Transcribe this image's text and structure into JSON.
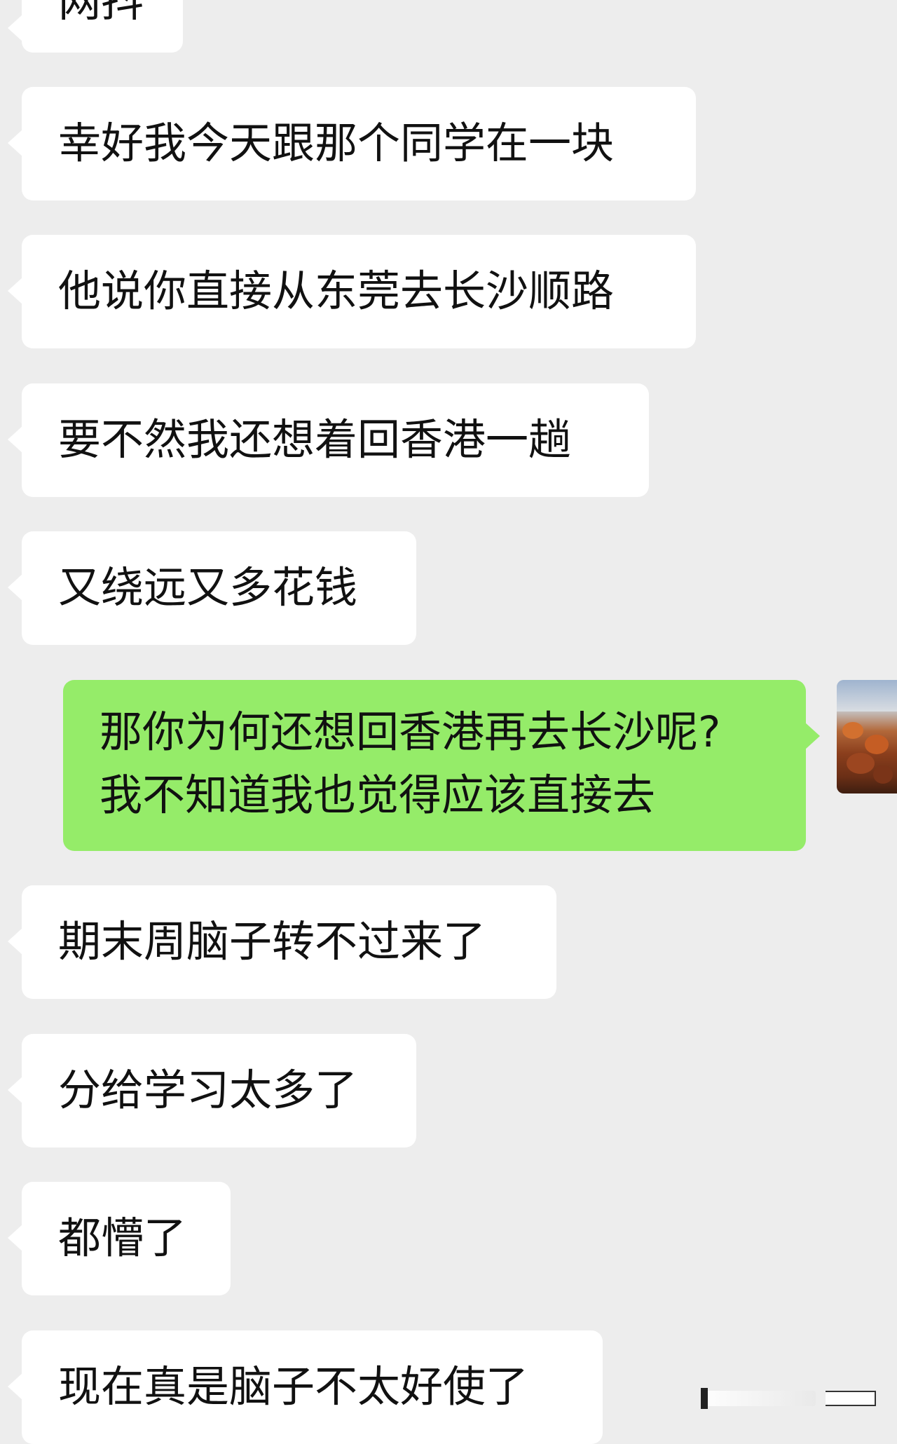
{
  "messages": [
    {
      "side": "in",
      "text": "网抖"
    },
    {
      "side": "in",
      "text": "幸好我今天跟那个同学在一块"
    },
    {
      "side": "in",
      "text": "他说你直接从东莞去长沙顺路"
    },
    {
      "side": "in",
      "text": "要不然我还想着回香港一趟"
    },
    {
      "side": "in",
      "text": "又绕远又多花钱"
    },
    {
      "side": "out",
      "lines": [
        "那你为何还想回香港再去长沙呢?",
        "我不知道我也觉得应该直接去"
      ]
    },
    {
      "side": "in",
      "text": "期末周脑子转不过来了"
    },
    {
      "side": "in",
      "text": "分给学习太多了"
    },
    {
      "side": "in",
      "text": "都懵了"
    },
    {
      "side": "in",
      "text": "现在真是脑子不太好使了"
    }
  ],
  "avatar_icon": "user-avatar-photo",
  "colors": {
    "background": "#ededed",
    "incoming_bubble": "#ffffff",
    "outgoing_bubble": "#95ec69",
    "text": "#111111"
  }
}
